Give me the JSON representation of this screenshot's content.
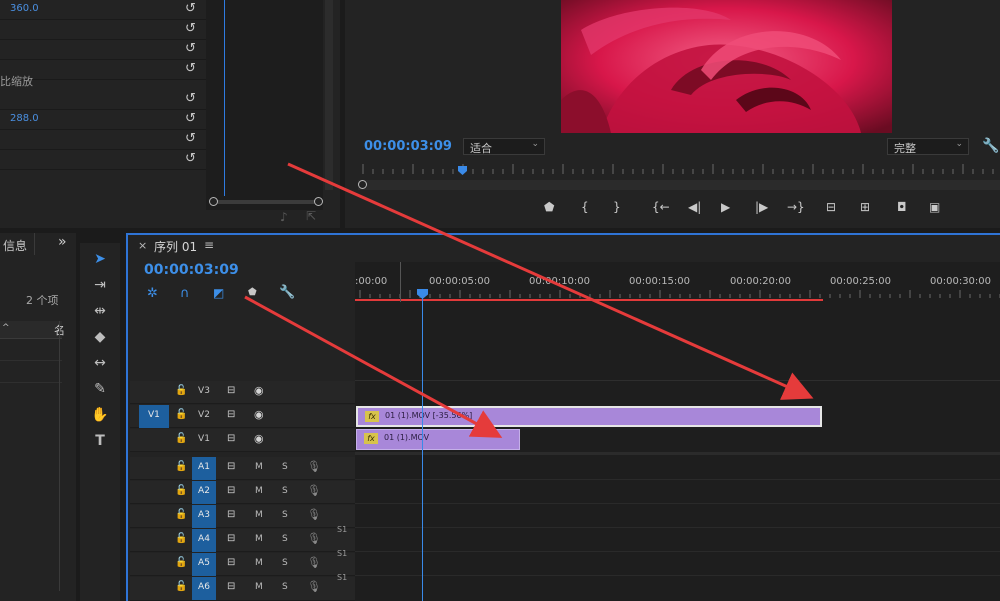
{
  "effect_controls": {
    "values": {
      "position_x": "360.0",
      "scale_label": "比缩放",
      "scale_value": "288.0"
    }
  },
  "program_monitor": {
    "timecode": "00:00:03:09",
    "fit_select": "适合",
    "quality_select": "完整"
  },
  "project_panel": {
    "tab_label": "信息",
    "more_label": "»",
    "item_count": "2 个项",
    "col_header": "名"
  },
  "timeline": {
    "tab_label": "序列 01",
    "menu_icon": "≡",
    "timecode": "00:00:03:09",
    "ruler_labels": [
      ":00:00",
      "00:00:05:00",
      "00:00:10:00",
      "00:00:15:00",
      "00:00:20:00",
      "00:00:25:00",
      "00:00:30:00"
    ],
    "video_tracks": [
      {
        "name": "V3",
        "source": ""
      },
      {
        "name": "V2",
        "source": "V1"
      },
      {
        "name": "V1",
        "source": ""
      }
    ],
    "audio_tracks": [
      "A1",
      "A2",
      "A3",
      "A4",
      "A5",
      "A6"
    ],
    "mute_label": "M",
    "solo_label": "S",
    "s1_label": "S1",
    "clips": [
      {
        "track": "V2",
        "label": "01 (1).MOV [-35.56%]"
      },
      {
        "track": "V1",
        "label": "01 (1).MOV"
      }
    ],
    "fx_label": "fx"
  },
  "colors": {
    "accent": "#2f74d6",
    "clip": "#a887d9",
    "annotation_arrow": "#e53b3b"
  }
}
